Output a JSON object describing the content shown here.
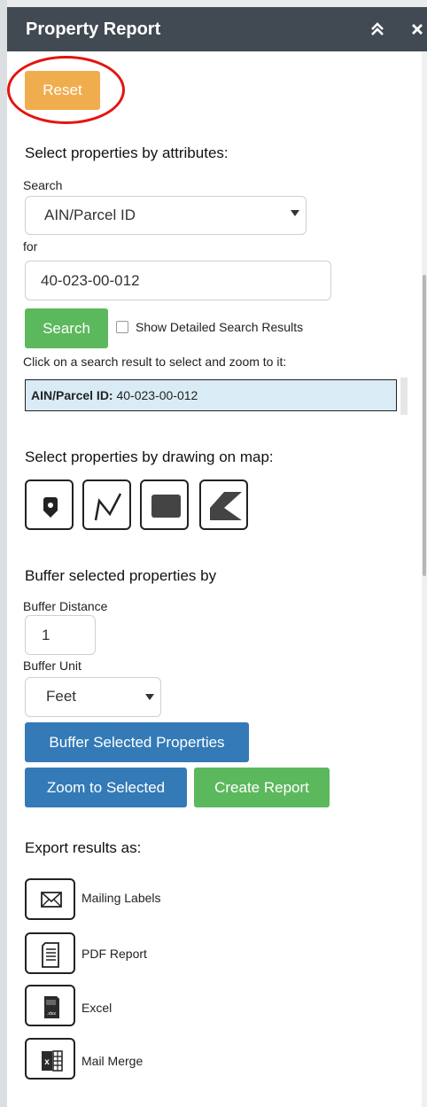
{
  "window": {
    "title": "Property Report",
    "collapse_icon": "double-chevron-up-icon",
    "close_icon": "close-icon"
  },
  "reset_button": "Reset",
  "attributes": {
    "heading": "Select properties by attributes:",
    "search_label": "Search",
    "search_field_value": "AIN/Parcel ID",
    "for_label": "for",
    "for_value": "40-023-00-012",
    "search_button": "Search",
    "detailed_results_checkbox": "Show Detailed Search Results",
    "detailed_results_checked": false,
    "results_hint": "Click on a search result to select and zoom to it:",
    "result": {
      "key": "AIN/Parcel ID:",
      "value": "40-023-00-012"
    }
  },
  "drawing": {
    "heading": "Select properties by drawing on map:",
    "tools": [
      "point-tool-icon",
      "polyline-tool-icon",
      "rectangle-tool-icon",
      "polygon-tool-icon"
    ]
  },
  "buffer": {
    "heading": "Buffer selected properties by",
    "distance_label": "Buffer Distance",
    "distance_value": "1",
    "unit_label": "Buffer Unit",
    "unit_value": "Feet",
    "buffer_button": "Buffer Selected Properties",
    "zoom_button": "Zoom to Selected",
    "report_button": "Create Report"
  },
  "export": {
    "heading": "Export results as:",
    "items": [
      {
        "label": "Mailing Labels",
        "icon": "envelope-icon"
      },
      {
        "label": "PDF Report",
        "icon": "document-icon"
      },
      {
        "label": "Excel",
        "icon": "xlsx-file-icon"
      },
      {
        "label": "Mail Merge",
        "icon": "word-excel-merge-icon"
      }
    ]
  },
  "colors": {
    "titlebar": "#414a53",
    "reset": "#f0ad4e",
    "primary": "#337ab7",
    "success": "#5cb85c",
    "result_highlight": "#d9ecf5",
    "annotation_circle": "#e3140f"
  }
}
